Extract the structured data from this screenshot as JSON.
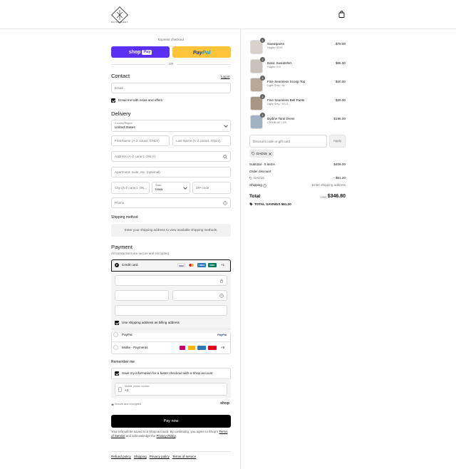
{
  "header": {
    "logo_text": "BATHDECENT",
    "bag_icon": "shopping-bag-icon"
  },
  "express": {
    "label": "Express checkout",
    "shoppay_label": "shop",
    "shoppay_suffix": "Pay",
    "paypal_pay": "Pay",
    "paypal_pal": "Pal",
    "or": "OR"
  },
  "contact": {
    "heading": "Contact",
    "login": "Log in",
    "email_placeholder": "Email",
    "newsletter_label": "Email me with news and offers"
  },
  "delivery": {
    "heading": "Delivery",
    "country_label": "Country/Region",
    "country_value": "United States",
    "first_name_placeholder": "First Name (A-Z caract. ONLY)",
    "last_name_placeholder": "Last Name (A-Z caract. ONLY)",
    "address_placeholder": "Address (A-Z caract. ONLY)",
    "apartment_placeholder": "Apartment, suite, etc. (optional)",
    "city_placeholder": "City (A-Z caract. ON...",
    "state_label": "State",
    "state_value": "Iowa",
    "zip_placeholder": "ZIP code",
    "phone_placeholder": "Phone"
  },
  "shipping_method": {
    "heading": "Shipping method",
    "message": "Enter your shipping address to view available shipping methods."
  },
  "payment": {
    "heading": "Payment",
    "subtitle": "All transactions are secure and encrypted.",
    "credit_card_label": "Credit card",
    "card_logos": [
      "VISA",
      "MC",
      "AMEX",
      "DISC"
    ],
    "more_cards": "+1",
    "billing_label": "Use shipping address as billing address",
    "paypal_label": "PayPal",
    "paypal_logo": "PayPal",
    "mollie_label": "Mollie - Payments",
    "mollie_more": "+9"
  },
  "remember": {
    "heading": "Remember me",
    "save_label": "Save my information for a faster checkout with a Shop account",
    "mobile_label": "Mobile phone number",
    "mobile_value": "+1",
    "secure_label": "Secure and encrypted",
    "shop_logo": "shop"
  },
  "pay_now": "Pay now",
  "legal": {
    "text1": "Your info will be saved to a Shop account. By continuing, you agree to Shop's",
    "terms": "Terms of Service",
    "text2": " and acknowledge the ",
    "privacy": "Privacy Policy",
    "text3": "."
  },
  "footer": [
    "Refund policy",
    "Shipping",
    "Privacy policy",
    "Terms of service"
  ],
  "cart": {
    "items": [
      {
        "name": "Sweatpants",
        "variant": "Hoglin / XXS",
        "price": "$79.00",
        "qty": "1"
      },
      {
        "name": "Basic Sweatshirt",
        "variant": "Hoglin / XS",
        "price": "$65.00",
        "qty": "1"
      },
      {
        "name": "Fine Seamless Scoop Top",
        "variant": "Light Grey / XL",
        "price": "$40.00",
        "qty": "1"
      },
      {
        "name": "Fine Seamless Bell Pants",
        "variant": "Light Grey / XS-S",
        "price": "$29.00",
        "qty": "1"
      },
      {
        "name": "Dydine Tank Dress",
        "variant": "CRA BLUE / XS",
        "price": "$195.00",
        "qty": "1"
      }
    ],
    "discount_placeholder": "Discount code or gift card",
    "apply": "Apply",
    "code": "DAD15",
    "subtotal_label": "Subtotal · 5 items",
    "subtotal_value": "$408.00",
    "order_discount_label": "Order discount",
    "discount_code": "DAD15",
    "discount_value": "- $61.20",
    "shipping_label": "Shipping",
    "shipping_value": "Enter shipping address",
    "total_label": "Total",
    "currency": "USD",
    "total_value": "$346.80",
    "savings_label": "TOTAL SAVINGS",
    "savings_value": "$61.20"
  },
  "colors": {
    "shoppay": "#5a31f4",
    "paypal": "#ffc439",
    "pay_button": "#000000"
  }
}
